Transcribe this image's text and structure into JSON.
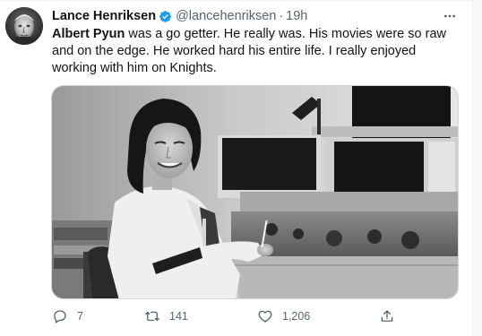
{
  "tweet": {
    "author_name": "Lance Henriksen",
    "author_handle": "@lancehenriksen",
    "separator": "·",
    "time": "19h",
    "text_bold": "Albert Pyun",
    "text_rest": " was a go getter. He really was. His movies were so raw and on the edge. He worked hard his entire life. I really enjoyed working with him on Knights.",
    "media_icon": "photo",
    "more_icon": "more-horizontal-icon"
  },
  "actions": {
    "reply_count": "7",
    "retweet_count": "141",
    "like_count": "1,206",
    "reply_icon": "reply-icon",
    "retweet_icon": "retweet-icon",
    "like_icon": "heart-icon",
    "share_icon": "share-icon"
  },
  "colors": {
    "text_primary": "#0f1419",
    "text_secondary": "#536471",
    "verified": "#1d9bf0",
    "divider": "#eff3f4"
  }
}
